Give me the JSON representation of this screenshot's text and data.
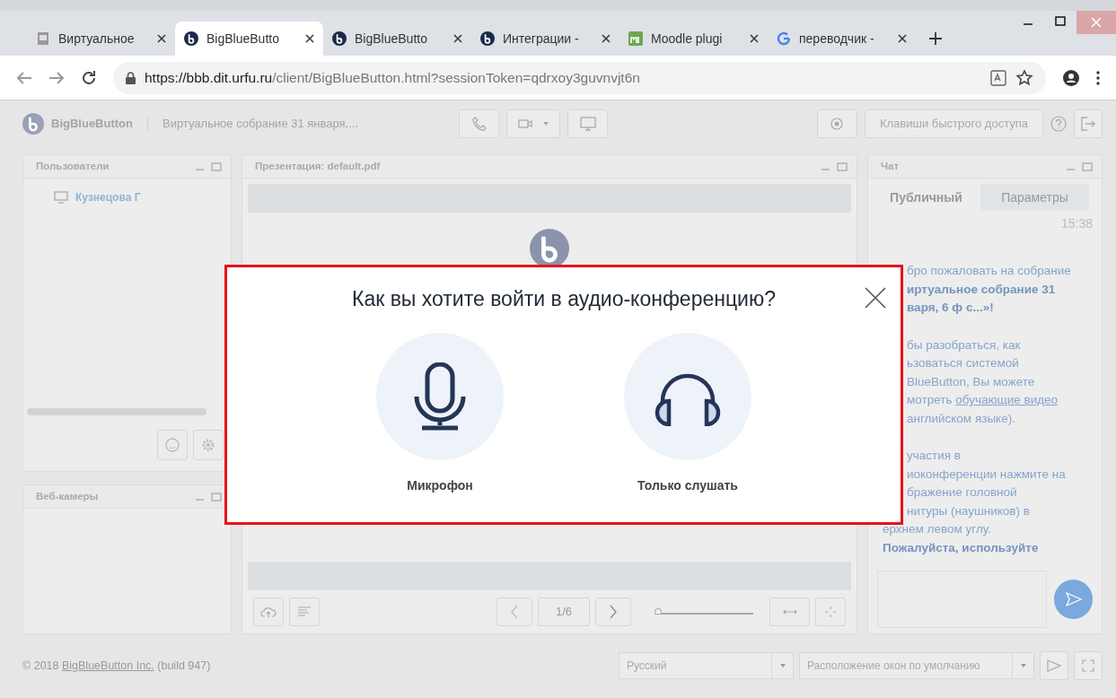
{
  "browser": {
    "tabs": [
      {
        "title": "Виртуальное",
        "kind": "page",
        "selected": false
      },
      {
        "title": "BigBlueButto",
        "kind": "bbb",
        "selected": true
      },
      {
        "title": "BigBlueButto",
        "kind": "bbb",
        "selected": false
      },
      {
        "title": "Интеграции -",
        "kind": "bbb",
        "selected": false
      },
      {
        "title": "Moodle plugi",
        "kind": "moodle",
        "selected": false
      },
      {
        "title": "переводчик -",
        "kind": "google",
        "selected": false
      }
    ],
    "url_host": "https://bbb.dit.urfu.ru",
    "url_path": "/client/BigBlueButton.html?sessionToken=qdrxoy3guvnvjt6n"
  },
  "header": {
    "brand": "BigBlueButton",
    "meeting_title": "Виртуальное собрание 31 января,...",
    "shortcut_button": "Клавиши быстрого доступа"
  },
  "users_panel": {
    "title": "Пользователи",
    "users": [
      {
        "name": "Кузнецова Г"
      }
    ]
  },
  "webcams_panel": {
    "title": "Веб-камеры"
  },
  "presentation": {
    "title": "Презентация: default.pdf",
    "page": "1/6",
    "zoom": {
      "level": 0
    }
  },
  "chat": {
    "title": "Чат",
    "tabs": [
      {
        "label": "Публичный",
        "selected": true
      },
      {
        "label": "Параметры",
        "selected": false
      }
    ],
    "time": "15:38",
    "paragraphs": [
      [
        {
          "text": "бро пожаловать на собрание",
          "bold": false,
          "covered": true
        },
        {
          "text": "иртуальное собрание 31",
          "bold": true,
          "covered": true
        },
        {
          "text": "варя, 6 ф с...»!",
          "bold": true,
          "covered": true
        }
      ],
      [
        {
          "text": "бы разобраться, как",
          "bold": false,
          "covered": true
        },
        {
          "text": "ьзоваться системой",
          "bold": false,
          "covered": true
        },
        {
          "text": "BlueButton, Вы можете",
          "bold": false,
          "covered": true
        },
        {
          "text": "мотреть ",
          "link": "обучающие видео",
          "bold": false,
          "covered": true
        },
        {
          "text": "английском языке).",
          "bold": false,
          "covered": true
        }
      ],
      [
        {
          "text": "участия в",
          "bold": false,
          "covered": true
        },
        {
          "text": "иоконференции нажмите на",
          "bold": false,
          "covered": true
        },
        {
          "text": "бражение головной",
          "bold": false,
          "covered": true
        },
        {
          "text": "нитуры (наушников) в",
          "bold": false,
          "covered": true
        },
        {
          "text": "ерхнем левом углу.",
          "bold": false,
          "covered": false
        },
        {
          "text": "Пожалуйста, используйте",
          "bold": true,
          "covered": false
        }
      ]
    ]
  },
  "footer": {
    "copyright": "© 2018 ",
    "company_link": "BigBlueButton Inc.",
    "build": " (build 947)",
    "language": "Русский",
    "layout": "Расположение окон по умолчанию"
  },
  "dialog": {
    "title": "Как вы хотите войти в аудио-конференцию?",
    "options": [
      {
        "label": "Микрофон",
        "kind": "microphone"
      },
      {
        "label": "Только слушать",
        "kind": "headphones"
      }
    ]
  }
}
